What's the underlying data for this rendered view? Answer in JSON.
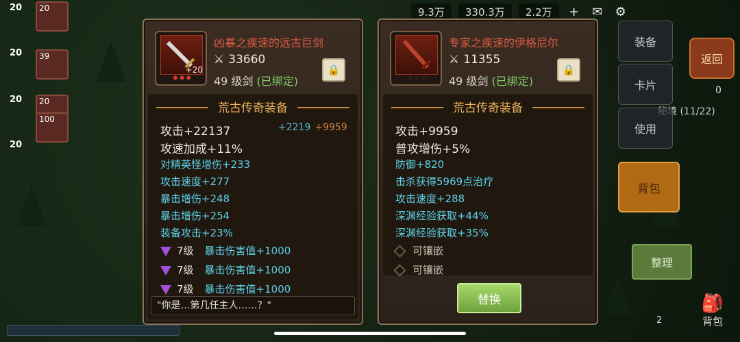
{
  "topbar": {
    "resource_1": "9.3万",
    "resource_2": "330.3万",
    "resource_3": "2.2万",
    "add_icon": "plus-icon",
    "mail_icon": "mail-icon",
    "settings_icon": "gear-icon"
  },
  "party": [
    {
      "level": "20",
      "slot_level": "20"
    },
    {
      "level": "20",
      "slot_level": "39"
    },
    {
      "level": "20",
      "slot_level": "20"
    },
    {
      "level": "20",
      "slot_level": "100"
    }
  ],
  "side_menu": {
    "equip": "装备",
    "cards": "卡片",
    "use": "使用",
    "bag": "背包",
    "sort": "整理",
    "return": "返回",
    "secret_label": "秘境 (11/22)",
    "gem_count": "0",
    "bag_bottom": "背包",
    "bag_bottom_count": "2"
  },
  "left_panel": {
    "name": "凶暴之疾速的远古巨剑",
    "power": "33660",
    "level": "49",
    "type": "级剑",
    "bound": "(已绑定)",
    "enhance": "+20",
    "section": "荒古传奇装备",
    "main_stats": [
      "攻击+22137",
      "攻速加成+11%"
    ],
    "compare_a": "+2219",
    "compare_b": "+9959",
    "sub_stats": [
      "对精英怪增伤+233",
      "攻击速度+277",
      "暴击增伤+248",
      "暴击增伤+254",
      "装备攻击+23%"
    ],
    "gems": [
      {
        "level": "7级",
        "text": "暴击伤害值+1000"
      },
      {
        "level": "7级",
        "text": "暴击伤害值+1000"
      },
      {
        "level": "7级",
        "text": "暴击伤害值+1000"
      }
    ],
    "quote": "\"你是…第几任主人……？\""
  },
  "right_panel": {
    "name": "专家之疾速的伊格尼尔",
    "power": "11355",
    "level": "49",
    "type": "级剑",
    "bound": "(已绑定)",
    "section": "荒古传奇装备",
    "main_stats": [
      "攻击+9959",
      "普攻增伤+5%"
    ],
    "sub_stats": [
      "防御+820",
      "击杀获得5969点治疗",
      "攻击速度+288",
      "深渊经验获取+44%",
      "深渊经验获取+35%"
    ],
    "sockets": [
      "可镶嵌",
      "可镶嵌"
    ],
    "replace": "替换"
  },
  "colors": {
    "item_name": "#e05a44",
    "section_title": "#f0b35a",
    "sub_stat": "#5dd1e8",
    "bound": "#7fd16a",
    "replace_button": "#8cc455"
  }
}
